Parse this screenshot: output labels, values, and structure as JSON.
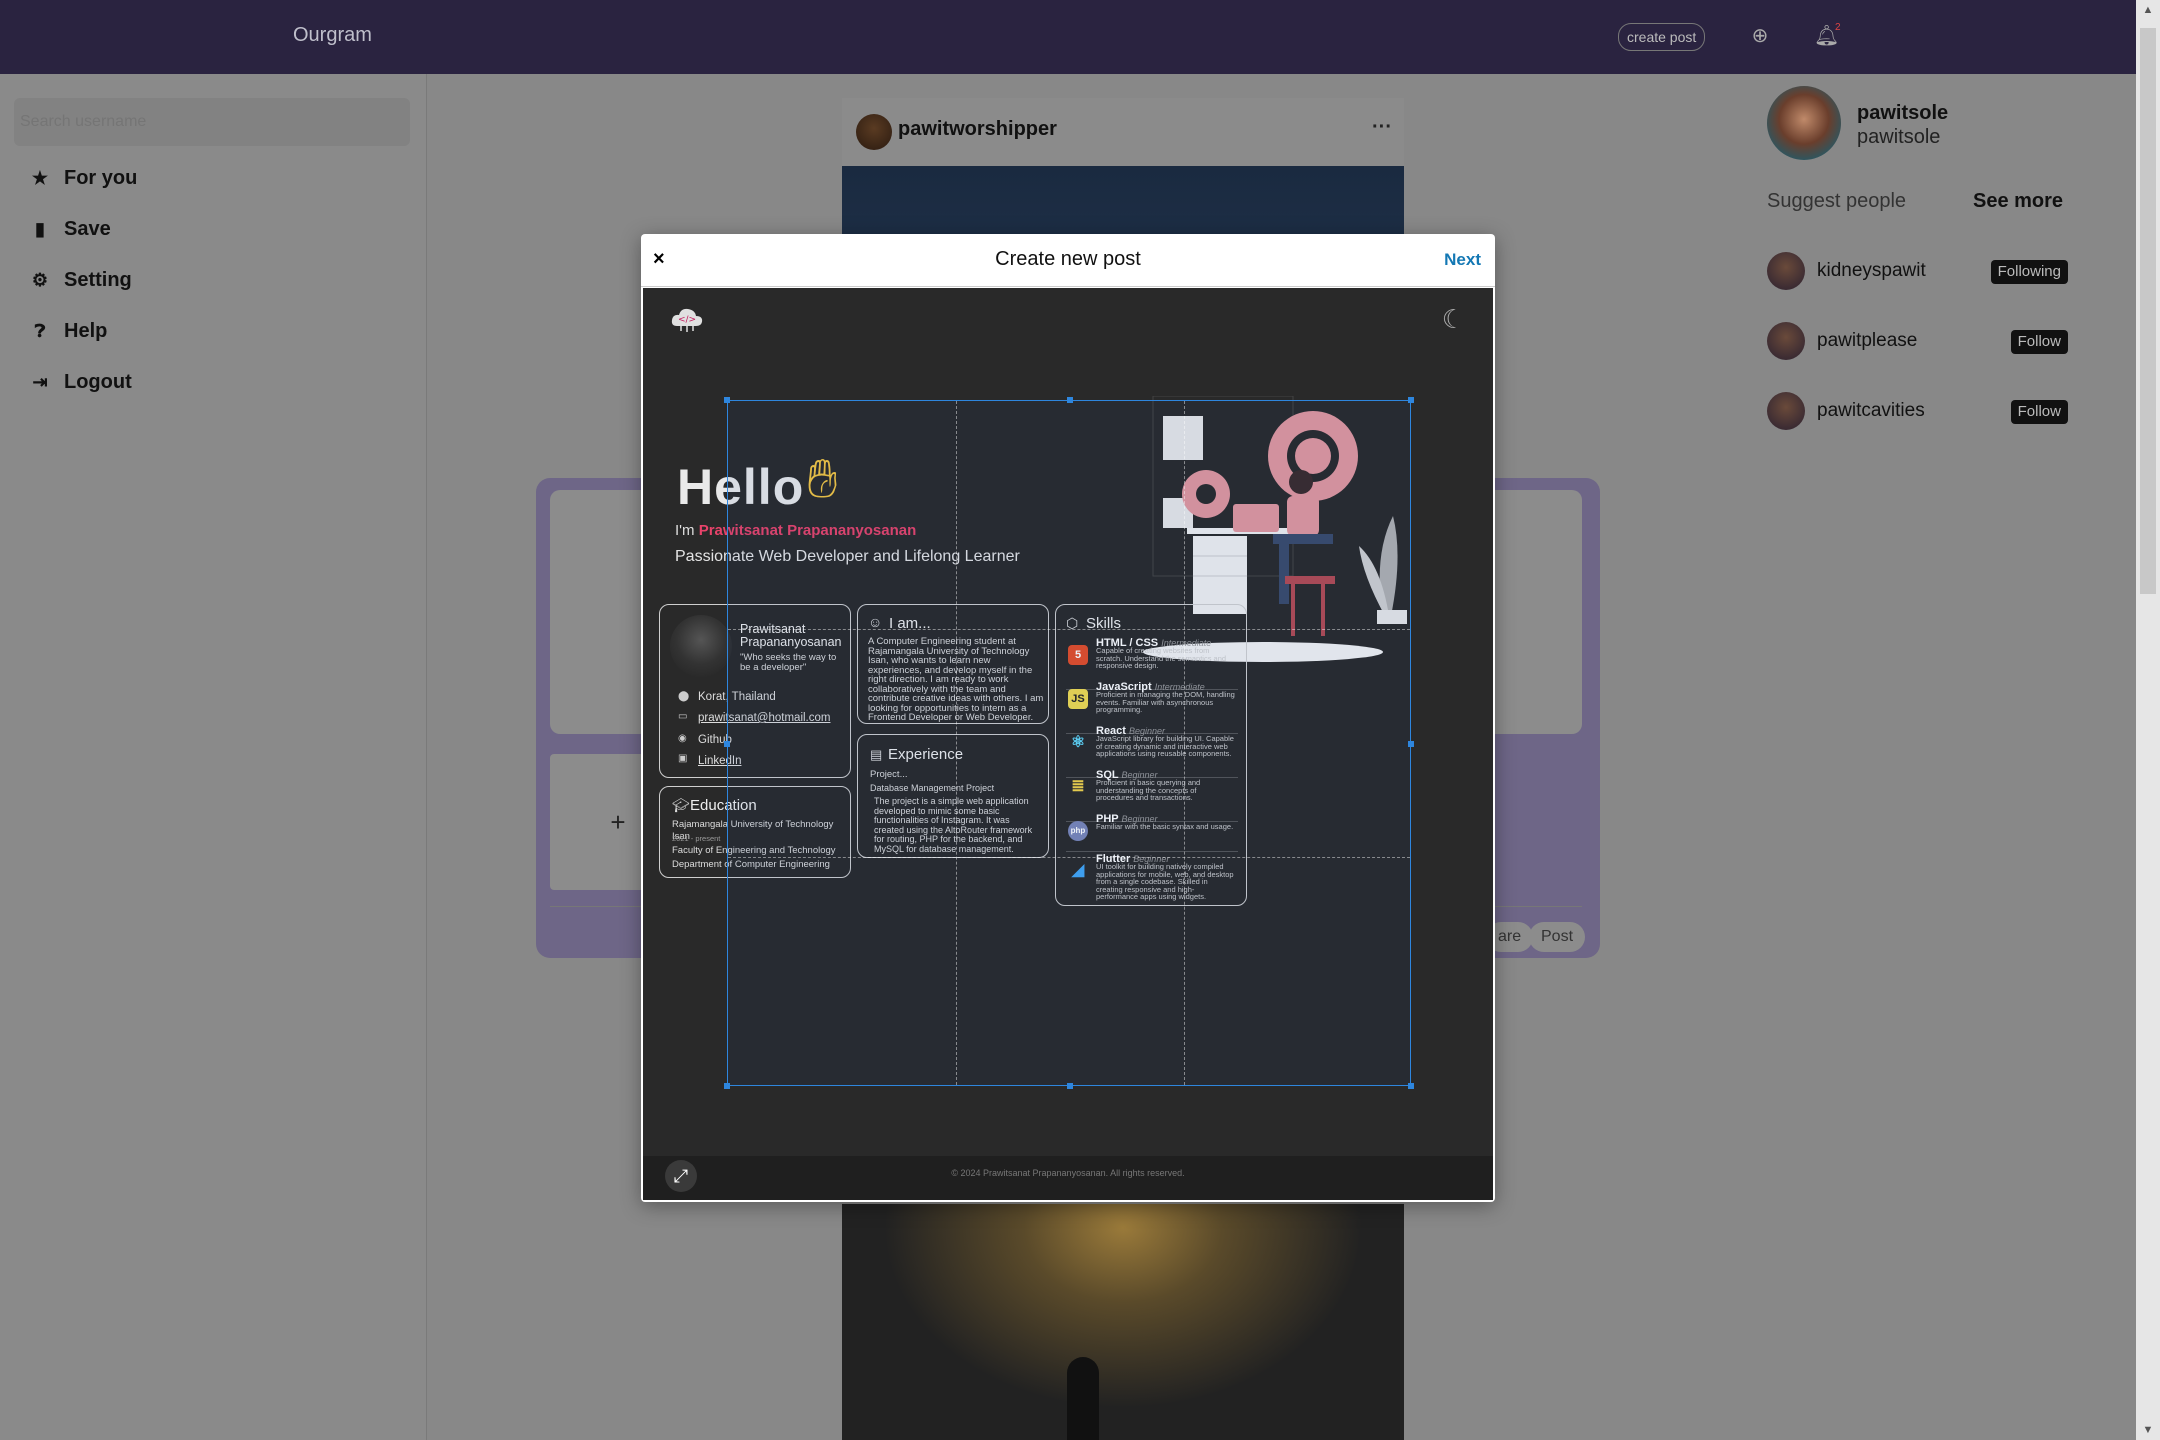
{
  "app": {
    "brand": "Ourgram",
    "create_post_label": "create post",
    "notif_badge": "2"
  },
  "sidebar": {
    "search_placeholder": "Search username",
    "items": [
      {
        "label": "For you",
        "icon": "star-icon"
      },
      {
        "label": "Save",
        "icon": "bookmark-icon"
      },
      {
        "label": "Setting",
        "icon": "gear-icon"
      },
      {
        "label": "Help",
        "icon": "question-icon"
      },
      {
        "label": "Logout",
        "icon": "logout-icon"
      }
    ]
  },
  "feed": {
    "post_user": "pawitworshipper",
    "more_label": "···",
    "panel_plus": "+",
    "panel_btn_share": "are",
    "panel_btn_post": "Post"
  },
  "profile": {
    "name": "pawitsole",
    "handle": "pawitsole",
    "suggest_title": "Suggest people",
    "see_more": "See more",
    "suggestions": [
      {
        "name": "kidneyspawit",
        "action": "Following"
      },
      {
        "name": "pawitplease",
        "action": "Follow"
      },
      {
        "name": "pawitcavities",
        "action": "Follow"
      }
    ]
  },
  "modal": {
    "close": "×",
    "title": "Create new post",
    "next": "Next"
  },
  "preview": {
    "hello": "Hello",
    "im_prefix": "I'm ",
    "full_name": "Prawitsanat Prapananyosanan",
    "role": "Passionate Web Developer and Lifelong Learner",
    "profile_card": {
      "name_line1": "Prawitsanat",
      "name_line2": "Prapananyosanan",
      "quote": "\"Who seeks the way to be a developer\"",
      "location": "Korat, Thailand",
      "email": "prawitsanat@hotmail.com",
      "github": "Github",
      "linkedin": "LinkedIn"
    },
    "iam_card": {
      "title": "I am...",
      "text": "A Computer Engineering student at Rajamangala University of Technology Isan, who wants to learn new experiences, and develop myself in the right direction. I am ready to work collaboratively with the team and contribute creative ideas with others. I am looking for opportunities to intern as a Frontend Developer or Web Developer."
    },
    "experience_card": {
      "title": "Experience",
      "sub": "Project...",
      "project": "Database Management Project",
      "desc": "The project is a simple web application developed to mimic some basic functionalities of Instagram. It was created using the AltoRouter framework for routing, PHP for the backend, and MySQL for database management."
    },
    "education_card": {
      "title": "Education",
      "school": "Rajamangala University of Technology Isan",
      "years": "2021 - present",
      "faculty": "Faculty of Engineering and Technology",
      "dept": "Department of Computer Engineering"
    },
    "skills_card": {
      "title": "Skills",
      "items": [
        {
          "name": "HTML / CSS",
          "level": "Intermediate",
          "desc": "Capable of creating websites from scratch. Understand the semantics and responsive design.",
          "icon": "html5-icon",
          "color": "#e44d26"
        },
        {
          "name": "JavaScript",
          "level": "Intermediate",
          "desc": "Proficient in managing the DOM, handling events. Familiar with asynchronous programming.",
          "icon": "js-icon",
          "color": "#f0db4f"
        },
        {
          "name": "React",
          "level": "Beginner",
          "desc": "JavaScript library for building UI. Capable of creating dynamic and interactive web applications using reusable components.",
          "icon": "react-icon",
          "color": "#61dafb"
        },
        {
          "name": "SQL",
          "level": "Beginner",
          "desc": "Proficient in basic querying and understanding the concepts of procedures and transactions.",
          "icon": "database-icon",
          "color": "#f5d547"
        },
        {
          "name": "PHP",
          "level": "Beginner",
          "desc": "Familiar with the basic syntax and usage.",
          "icon": "php-icon",
          "color": "#7a86b8"
        },
        {
          "name": "Flutter",
          "level": "Beginner",
          "desc": "UI toolkit for building natively compiled applications for mobile, web, and desktop from a single codebase. Skilled in creating responsive and high-performance apps using widgets.",
          "icon": "flutter-icon",
          "color": "#42a5f5"
        }
      ]
    },
    "footer": "© 2024 Prawitsanat Prapananyosanan. All rights reserved."
  },
  "colors": {
    "accent_pink": "#e8436a",
    "link_blue": "#1478b4",
    "crop_blue": "#2e86de",
    "topbar": "#2a2340"
  }
}
